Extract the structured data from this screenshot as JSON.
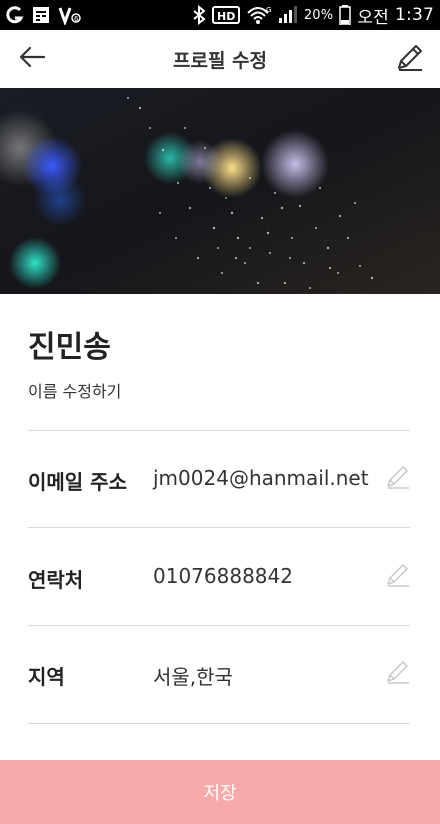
{
  "status_bar": {
    "battery_percent": "20%",
    "ampm": "오전",
    "time": "1:37",
    "left_icons": [
      "carrier-g-icon",
      "calendar-icon",
      "voice-icon"
    ],
    "right_icons": [
      "bluetooth-icon",
      "hd-icon",
      "wifi-icon",
      "signal-icon",
      "battery-icon"
    ]
  },
  "header": {
    "title": "프로필 수정",
    "back_icon": "back-arrow-icon",
    "edit_icon": "pencil-icon"
  },
  "profile": {
    "name": "진민송",
    "edit_name_label": "이름 수정하기"
  },
  "fields": [
    {
      "label": "이메일 주소",
      "value": "jm0024@hanmail.net",
      "icon": "pencil-icon"
    },
    {
      "label": "연락처",
      "value": "01076888842",
      "icon": "pencil-icon"
    },
    {
      "label": "지역",
      "value": "서울,한국",
      "icon": "pencil-icon"
    }
  ],
  "save_button": {
    "label": "저장",
    "color": "#f8aaaa"
  }
}
